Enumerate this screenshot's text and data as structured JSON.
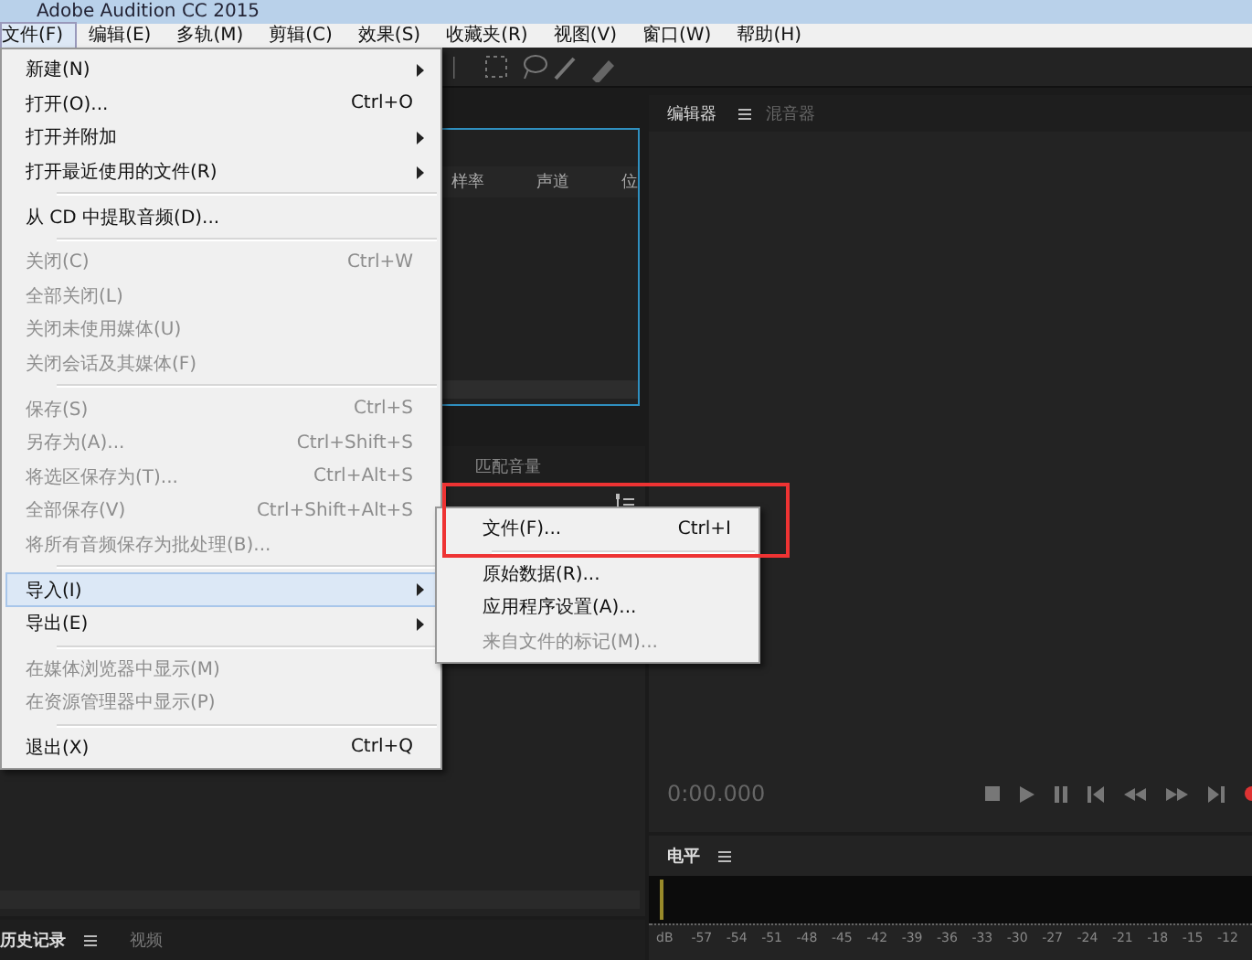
{
  "window": {
    "title": "Adobe Audition CC 2015"
  },
  "menu_bar": [
    {
      "label": "文件(F)",
      "selected": true
    },
    {
      "label": "编辑(E)",
      "selected": false
    },
    {
      "label": "多轨(M)",
      "selected": false
    },
    {
      "label": "剪辑(C)",
      "selected": false
    },
    {
      "label": "效果(S)",
      "selected": false
    },
    {
      "label": "收藏夹(R)",
      "selected": false
    },
    {
      "label": "视图(V)",
      "selected": false
    },
    {
      "label": "窗口(W)",
      "selected": false
    },
    {
      "label": "帮助(H)",
      "selected": false
    }
  ],
  "file_menu": {
    "groups": [
      [
        {
          "label": "新建(N)",
          "has_submenu": true,
          "disabled": false,
          "selected": false
        },
        {
          "label": "打开(O)...",
          "shortcut": "Ctrl+O",
          "has_submenu": false,
          "disabled": false,
          "selected": false
        },
        {
          "label": "打开并附加",
          "has_submenu": true,
          "disabled": false,
          "selected": false
        },
        {
          "label": "打开最近使用的文件(R)",
          "has_submenu": true,
          "disabled": false,
          "selected": false
        }
      ],
      [
        {
          "label": "从 CD 中提取音频(D)...",
          "has_submenu": false,
          "disabled": false,
          "selected": false
        }
      ],
      [
        {
          "label": "关闭(C)",
          "shortcut": "Ctrl+W",
          "has_submenu": false,
          "disabled": true,
          "selected": false
        },
        {
          "label": "全部关闭(L)",
          "has_submenu": false,
          "disabled": true,
          "selected": false
        },
        {
          "label": "关闭未使用媒体(U)",
          "has_submenu": false,
          "disabled": true,
          "selected": false
        },
        {
          "label": "关闭会话及其媒体(F)",
          "has_submenu": false,
          "disabled": true,
          "selected": false
        }
      ],
      [
        {
          "label": "保存(S)",
          "shortcut": "Ctrl+S",
          "has_submenu": false,
          "disabled": true,
          "selected": false
        },
        {
          "label": "另存为(A)...",
          "shortcut": "Ctrl+Shift+S",
          "has_submenu": false,
          "disabled": true,
          "selected": false
        },
        {
          "label": "将选区保存为(T)...",
          "shortcut": "Ctrl+Alt+S",
          "has_submenu": false,
          "disabled": true,
          "selected": false
        },
        {
          "label": "全部保存(V)",
          "shortcut": "Ctrl+Shift+Alt+S",
          "has_submenu": false,
          "disabled": true,
          "selected": false
        },
        {
          "label": "将所有音频保存为批处理(B)...",
          "has_submenu": false,
          "disabled": true,
          "selected": false
        }
      ],
      [
        {
          "label": "导入(I)",
          "has_submenu": true,
          "disabled": false,
          "selected": true
        },
        {
          "label": "导出(E)",
          "has_submenu": true,
          "disabled": false,
          "selected": false
        }
      ],
      [
        {
          "label": "在媒体浏览器中显示(M)",
          "has_submenu": false,
          "disabled": true,
          "selected": false
        },
        {
          "label": "在资源管理器中显示(P)",
          "has_submenu": false,
          "disabled": true,
          "selected": false
        }
      ],
      [
        {
          "label": "退出(X)",
          "shortcut": "Ctrl+Q",
          "has_submenu": false,
          "disabled": false,
          "selected": false
        }
      ]
    ]
  },
  "import_submenu": {
    "highlighted": true,
    "groups": [
      [
        {
          "label": "文件(F)...",
          "shortcut": "Ctrl+I",
          "disabled": false
        }
      ],
      [
        {
          "label": "原始数据(R)...",
          "disabled": false
        },
        {
          "label": "应用程序设置(A)...",
          "disabled": false
        },
        {
          "label": "来自文件的标记(M)...",
          "disabled": true
        }
      ]
    ]
  },
  "files_panel": {
    "columns": [
      "样率",
      "声道",
      "位"
    ]
  },
  "lower_left_panel": {
    "tab": "匹配音量"
  },
  "editor_panel": {
    "tabs": [
      {
        "label": "编辑器",
        "selected": true
      },
      {
        "label": "混音器",
        "selected": false
      }
    ],
    "time": "0:00.000"
  },
  "level_panel": {
    "title": "电平",
    "ticks": [
      "dB",
      "-57",
      "-54",
      "-51",
      "-48",
      "-45",
      "-42",
      "-39",
      "-36",
      "-33",
      "-30",
      "-27",
      "-24",
      "-21",
      "-18",
      "-15",
      "-12"
    ]
  },
  "bottom_tabs": [
    {
      "label": "历史记录",
      "selected": true
    },
    {
      "label": "视频",
      "selected": false
    }
  ]
}
